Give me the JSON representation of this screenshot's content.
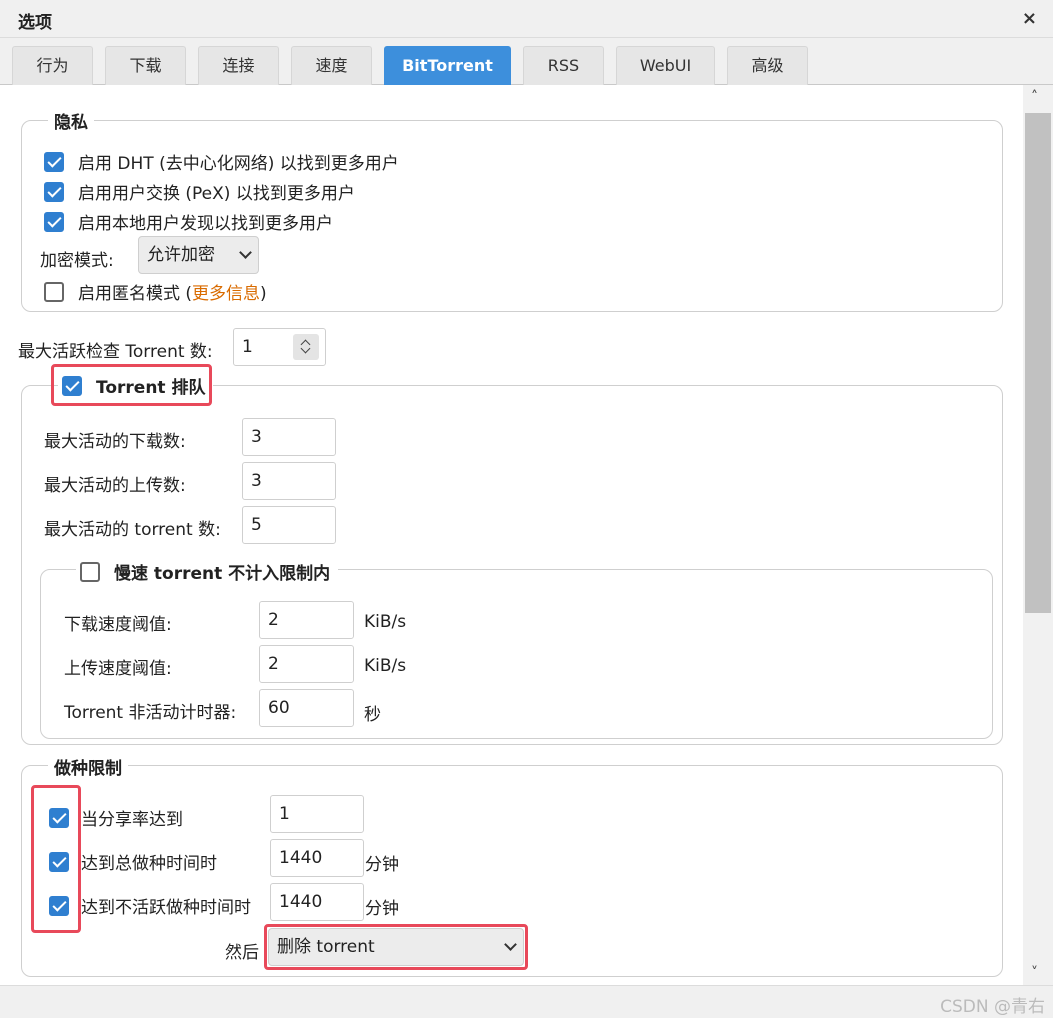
{
  "dialog": {
    "title": "选项",
    "close_glyph": "×"
  },
  "tabs": [
    {
      "label": "行为"
    },
    {
      "label": "下载"
    },
    {
      "label": "连接"
    },
    {
      "label": "速度"
    },
    {
      "label": "BitTorrent",
      "active": true
    },
    {
      "label": "RSS"
    },
    {
      "label": "WebUI"
    },
    {
      "label": "高级"
    }
  ],
  "privacy": {
    "legend": "隐私",
    "dht_label": "启用 DHT (去中心化网络) 以找到更多用户",
    "dht_checked": true,
    "pex_label": "启用用户交换 (PeX) 以找到更多用户",
    "pex_checked": true,
    "lsd_label": "启用本地用户发现以找到更多用户",
    "lsd_checked": true,
    "encryption_label": "加密模式:",
    "encryption_value": "允许加密",
    "anon_label_prefix": "启用匿名模式 (",
    "anon_link": "更多信息",
    "anon_label_suffix": ")",
    "anon_checked": false
  },
  "max_checking": {
    "label": "最大活跃检查 Torrent 数:",
    "value": "1"
  },
  "queueing": {
    "legend": "Torrent 排队",
    "checked": true,
    "max_downloads_label": "最大活动的下载数:",
    "max_downloads": "3",
    "max_uploads_label": "最大活动的上传数:",
    "max_uploads": "3",
    "max_torrents_label": "最大活动的 torrent 数:",
    "max_torrents": "5"
  },
  "slow_torrents": {
    "legend": "慢速 torrent 不计入限制内",
    "checked": false,
    "dl_threshold_label": "下载速度阈值:",
    "dl_threshold": "2",
    "dl_unit": "KiB/s",
    "ul_threshold_label": "上传速度阈值:",
    "ul_threshold": "2",
    "ul_unit": "KiB/s",
    "inactive_timer_label": "Torrent 非活动计时器:",
    "inactive_timer": "60",
    "inactive_unit": "秒"
  },
  "seeding_limits": {
    "legend": "做种限制",
    "ratio_label": "当分享率达到",
    "ratio_checked": true,
    "ratio": "1",
    "seed_time_label": "达到总做种时间时",
    "seed_time_checked": true,
    "seed_time": "1440",
    "seed_time_unit": "分钟",
    "inactive_seed_label": "达到不活跃做种时间时",
    "inactive_seed_checked": true,
    "inactive_seed_time": "1440",
    "inactive_seed_unit": "分钟",
    "then_label": "然后",
    "action": "删除 torrent"
  },
  "watermark": "CSDN @青右",
  "colors": {
    "accent": "#3d8fdc",
    "highlight": "#e8495a",
    "link": "#d96b00"
  }
}
